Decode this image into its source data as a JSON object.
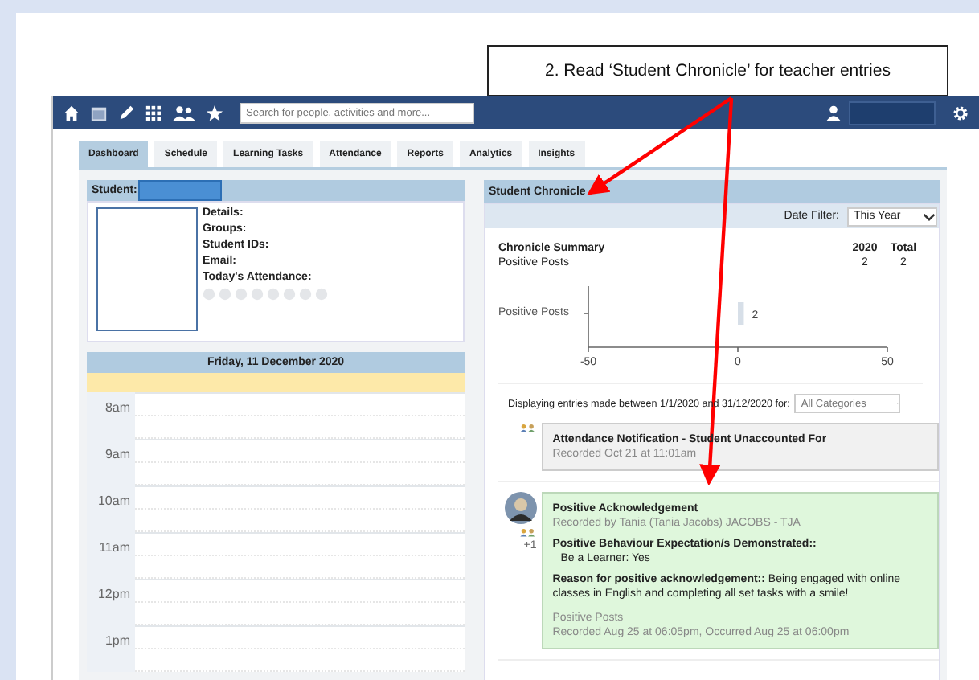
{
  "callout": {
    "text": "2. Read ‘Student Chronicle’ for teacher entries"
  },
  "nav": {
    "search": {
      "placeholder": "Search for people, activities and more..."
    }
  },
  "tabs": [
    {
      "label": "Dashboard",
      "selected": true
    },
    {
      "label": "Schedule",
      "selected": false
    },
    {
      "label": "Learning Tasks",
      "selected": false
    },
    {
      "label": "Attendance",
      "selected": false
    },
    {
      "label": "Reports",
      "selected": false
    },
    {
      "label": "Analytics",
      "selected": false
    },
    {
      "label": "Insights",
      "selected": false
    }
  ],
  "student_panel": {
    "label": "Student:",
    "fields": [
      "Details:",
      "Groups:",
      "Student IDs:",
      "Email:",
      "Today's Attendance:"
    ]
  },
  "schedule": {
    "date": "Friday, 11 December 2020",
    "times": [
      "8am",
      "9am",
      "10am",
      "11am",
      "12pm",
      "1pm"
    ]
  },
  "chronicle": {
    "title": "Student Chronicle",
    "date_filter": {
      "label": "Date Filter:",
      "value": "This Year"
    },
    "summary": {
      "title": "Chronicle Summary",
      "columns": [
        "2020",
        "Total"
      ],
      "rows": [
        {
          "label": "Positive Posts",
          "values": [
            "2",
            "2"
          ]
        }
      ]
    },
    "chart_data": {
      "type": "bar",
      "orientation": "horizontal",
      "categories": [
        "Positive Posts"
      ],
      "values": [
        2
      ],
      "xlim": [
        -50,
        50
      ],
      "xticks": [
        -50,
        0,
        50
      ],
      "data_labels": true
    },
    "filter_text": "Displaying entries made between 1/1/2020 and 31/12/2020 for:",
    "category": {
      "placeholder": "All Categories"
    },
    "entries": [
      {
        "kind": "notification",
        "title": "Attendance Notification - Student Unaccounted For",
        "footer": [
          "Recorded Oct 21 at 11:01am"
        ]
      },
      {
        "kind": "positive",
        "title": "Positive Acknowledgement",
        "byline": "Recorded by Tania (Tania Jacobs) JACOBS - TJA",
        "extra": "+1",
        "sections": [
          {
            "kind": "block",
            "heading": "Positive Behaviour Expectation/s Demonstrated::",
            "text": "Be a Learner: Yes"
          },
          {
            "kind": "inline",
            "heading": "Reason for positive acknowledgement::",
            "text": "Being engaged with online classes in English and completing all set tasks with a smile!"
          }
        ],
        "footer": [
          "Positive Posts",
          "Recorded Aug 25 at 06:05pm, Occurred Aug 25 at 06:00pm"
        ]
      }
    ]
  }
}
